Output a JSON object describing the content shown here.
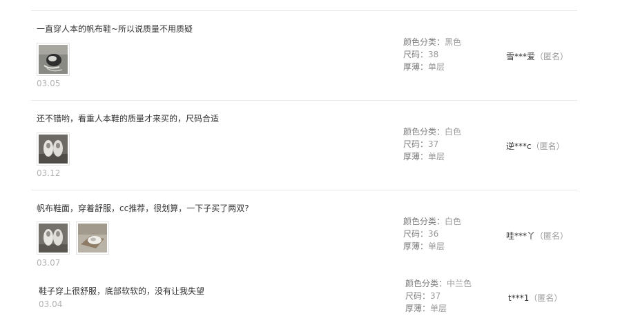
{
  "reviews": [
    {
      "content": "一直穿人本的帆布鞋~所以说质量不用质疑",
      "date": "03.05",
      "color_label": "颜色分类：",
      "color_value": "黑色",
      "size_label": "尺码：",
      "size_value": "38",
      "thickness_label": "厚薄：",
      "thickness_value": "单层",
      "user": "雪***爱",
      "anon": "（匿名）",
      "photos": [
        "shoe-photo-black"
      ]
    },
    {
      "content": "还不错哟，看重人本鞋的质量才来买的，尺码合适",
      "date": "03.12",
      "color_label": "颜色分类：",
      "color_value": "白色",
      "size_label": "尺码：",
      "size_value": "37",
      "thickness_label": "厚薄：",
      "thickness_value": "单层",
      "user": "逆***c",
      "anon": "（匿名）",
      "photos": [
        "shoe-photo-white"
      ]
    },
    {
      "content": "帆布鞋面，穿着舒服，cc推荐，很划算，一下子买了两双?",
      "date": "03.07",
      "color_label": "颜色分类：",
      "color_value": "白色",
      "size_label": "尺码：",
      "size_value": "36",
      "thickness_label": "厚薄：",
      "thickness_value": "单层",
      "user": "哇***丫",
      "anon": "（匿名）",
      "photos": [
        "shoe-photo-white",
        "shoe-photo-box"
      ]
    },
    {
      "content": "鞋子穿上很舒服，底部软软的，没有让我失望",
      "date": "03.04",
      "color_label": "颜色分类：",
      "color_value": "中兰色",
      "size_label": "尺码：",
      "size_value": "37",
      "thickness_label": "厚薄：",
      "thickness_value": "单层",
      "user": "t***1",
      "anon": "（匿名）",
      "photos": []
    }
  ]
}
